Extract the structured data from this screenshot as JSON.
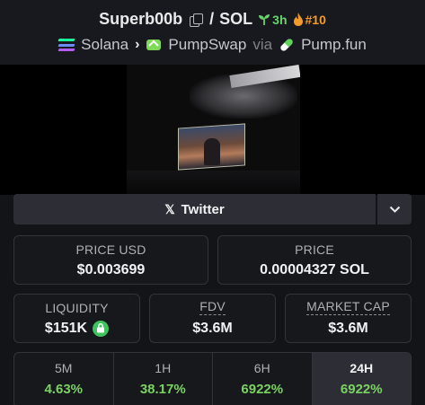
{
  "header": {
    "token_name": "Superb00b",
    "quote": "SOL",
    "separator": "/",
    "age": "3h",
    "rank": "#10",
    "breadcrumb": {
      "chain": "Solana",
      "dex": "PumpSwap",
      "via_label": "via",
      "launchpad": "Pump.fun"
    }
  },
  "socials": {
    "twitter_label": "Twitter"
  },
  "prices": {
    "price_usd_label": "PRICE USD",
    "price_usd": "$0.003699",
    "price_label": "PRICE",
    "price_native": "0.00004327 SOL"
  },
  "stats": {
    "liquidity_label": "LIQUIDITY",
    "liquidity": "$151K",
    "fdv_label": "FDV",
    "fdv": "$3.6M",
    "mcap_label": "MARKET CAP",
    "mcap": "$3.6M"
  },
  "timeframes": [
    {
      "label": "5M",
      "change": "4.63%"
    },
    {
      "label": "1H",
      "change": "38.17%"
    },
    {
      "label": "6H",
      "change": "6922%"
    },
    {
      "label": "24H",
      "change": "6922%"
    }
  ],
  "active_timeframe": "24H",
  "colors": {
    "positive": "#7bd262",
    "age_green": "#66d46a",
    "rank_orange": "#f39b2a",
    "lock_green": "#3ec45c",
    "solana_top": "#19fb9b",
    "solana_mid": "#6c8cf5",
    "solana_bottom": "#b45cf0"
  },
  "icons": {
    "copy": "copy-icon",
    "age": "seedling-icon",
    "rank": "flame-icon",
    "chain": "solana-icon",
    "dex": "pumpswap-icon",
    "launchpad": "pill-icon",
    "twitter": "x-icon",
    "more": "chevron-down-icon",
    "liquidity": "lock-icon"
  }
}
